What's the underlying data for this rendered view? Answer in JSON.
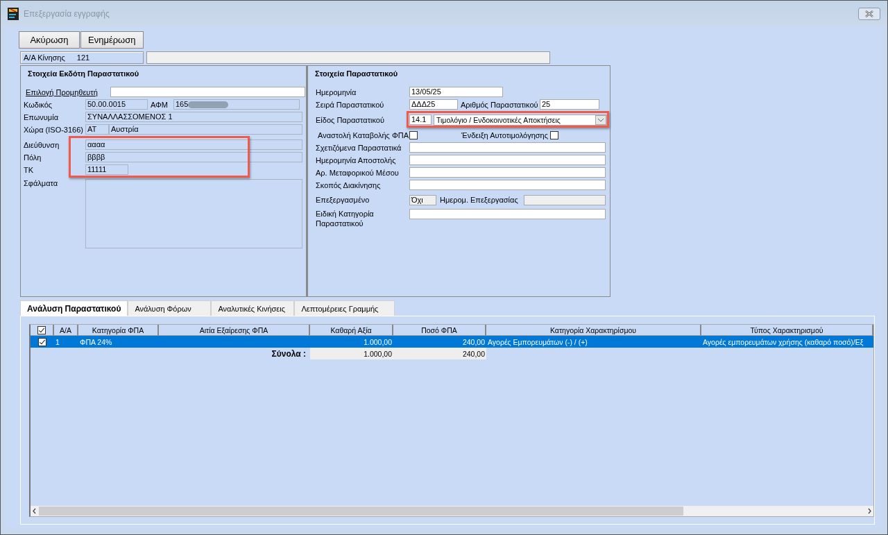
{
  "window": {
    "title": "Επεξεργασία εγγραφής"
  },
  "buttons": [
    "Ακύρωση",
    "Ενημέρωση"
  ],
  "record": {
    "label": "Α/Α Κίνησης",
    "value": "121"
  },
  "issuer": {
    "title": "Στοιχεία Εκδότη Παραστατικού",
    "supplier_link": "Επιλογή Προμηθευτή",
    "code": {
      "label": "Κωδικός",
      "value": "50.00.0015"
    },
    "vat_no": {
      "label": "ΑΦΜ",
      "value": "165"
    },
    "name": {
      "label": "Επωνυμία",
      "value": "ΣΥΝΑΛΛΑΣΣΟΜΕΝΟΣ 1"
    },
    "country": {
      "label": "Χώρα (ISO-3166)",
      "code": "AT",
      "value": "Αυστρία"
    },
    "address": {
      "label": "Διεύθυνση",
      "value": "αααα"
    },
    "city": {
      "label": "Πόλη",
      "value": "ββββ"
    },
    "zip": {
      "label": "ΤΚ",
      "value": "11111"
    },
    "errors": {
      "label": "Σφάλματα"
    }
  },
  "document": {
    "title": "Στοιχεία Παραστατικού",
    "date": {
      "label": "Ημερομηνία",
      "value": "13/05/25"
    },
    "series": {
      "label": "Σειρά Παραστατικού",
      "value": "ΔΔΔ25"
    },
    "number": {
      "label": "Αριθμός Παραστατικού",
      "value": "25"
    },
    "type": {
      "label": "Είδος Παραστατικού",
      "code": "14.1",
      "value": "Τιμολόγιο / Ενδοκοινοτικές Αποκτήσεις"
    },
    "vat_suspension": {
      "label": "Αναστολή Καταβολής ΦΠΑ",
      "checked": false
    },
    "self_billing": {
      "label": "Ένδειξη Αυτοτιμολόγησης",
      "checked": false
    },
    "fields": [
      {
        "label": "Σχετιζόμενα Παραστατικά"
      },
      {
        "label": "Ημερομηνία Αποστολής"
      },
      {
        "label": "Αρ. Μεταφορικού Μέσου"
      },
      {
        "label": "Σκοπός Διακίνησης"
      }
    ],
    "processed": {
      "label": "Επεξεργασμένο",
      "value": "Όχι"
    },
    "processed_date": {
      "label": "Ημερομ. Επεξεργασίας"
    },
    "special_category": {
      "label": "Ειδική Κατηγορία Παραστατικού"
    }
  },
  "tabs": [
    {
      "label": "Ανάλυση Παραστατικού",
      "selected": true
    },
    {
      "label": "Ανάλυση Φόρων",
      "selected": false
    },
    {
      "label": "Αναλυτικές Κινήσεις",
      "selected": false
    },
    {
      "label": "Λεπτομέρειες Γραμμής",
      "selected": false
    }
  ],
  "table": {
    "header_checked": true,
    "columns": [
      "Α/Α",
      "Κατηγορία ΦΠΑ",
      "Αιτία Εξαίρεσης ΦΠΑ",
      "Καθαρή Αξία",
      "Ποσό ΦΠΑ",
      "Κατηγορία Χαρακτηρίσμου",
      "Τύπος Χαρακτηρισμού"
    ],
    "rows": [
      {
        "checked": true,
        "selected": true,
        "cells": [
          "1",
          "ΦΠΑ 24%",
          "",
          "1.000,00",
          "240,00",
          "Αγορές Εμπορευμάτων (-) / (+)",
          "Αγορές εμπορευμάτων χρήσης (καθαρό ποσό)/Εξ"
        ]
      }
    ],
    "totals": {
      "label": "Σύνολα :",
      "net": "1.000,00",
      "vat": "240,00"
    }
  }
}
